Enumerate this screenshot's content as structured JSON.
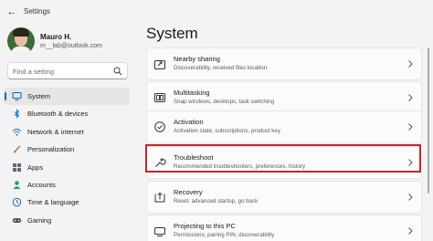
{
  "window": {
    "title": "Settings"
  },
  "user": {
    "name": "Mauro H.",
    "email": "m__lab@outlook.com"
  },
  "search": {
    "placeholder": "Find a setting"
  },
  "sidebar": {
    "items": [
      {
        "label": "System",
        "icon": "monitor-icon",
        "active": true
      },
      {
        "label": "Bluetooth & devices",
        "icon": "bluetooth-icon"
      },
      {
        "label": "Network & internet",
        "icon": "wifi-icon"
      },
      {
        "label": "Personalization",
        "icon": "paintbrush-icon"
      },
      {
        "label": "Apps",
        "icon": "apps-grid-icon"
      },
      {
        "label": "Accounts",
        "icon": "person-icon"
      },
      {
        "label": "Time & language",
        "icon": "globe-clock-icon"
      },
      {
        "label": "Gaming",
        "icon": "gamepad-icon"
      }
    ]
  },
  "main": {
    "title": "System",
    "cards": [
      {
        "title": "Nearby sharing",
        "subtitle": "Discoverability, received files location",
        "icon": "share-icon"
      },
      {
        "title": "Multitasking",
        "subtitle": "Snap windows, desktops, task switching",
        "icon": "multitasking-icon"
      },
      {
        "title": "Activation",
        "subtitle": "Activation state, subscriptions, product key",
        "icon": "check-circle-icon"
      },
      {
        "title": "Troubleshoot",
        "subtitle": "Recommended troubleshooters, preferences, history",
        "icon": "wrench-icon",
        "highlighted": true
      },
      {
        "title": "Recovery",
        "subtitle": "Reset, advanced startup, go back",
        "icon": "recovery-icon"
      },
      {
        "title": "Projecting to this PC",
        "subtitle": "Permissions, pairing PIN, discoverability",
        "icon": "projector-icon"
      }
    ]
  },
  "colors": {
    "accent": "#0067c0",
    "highlight_border": "#c0272d",
    "background": "#f3f3f3",
    "card": "#fbfbfb"
  }
}
